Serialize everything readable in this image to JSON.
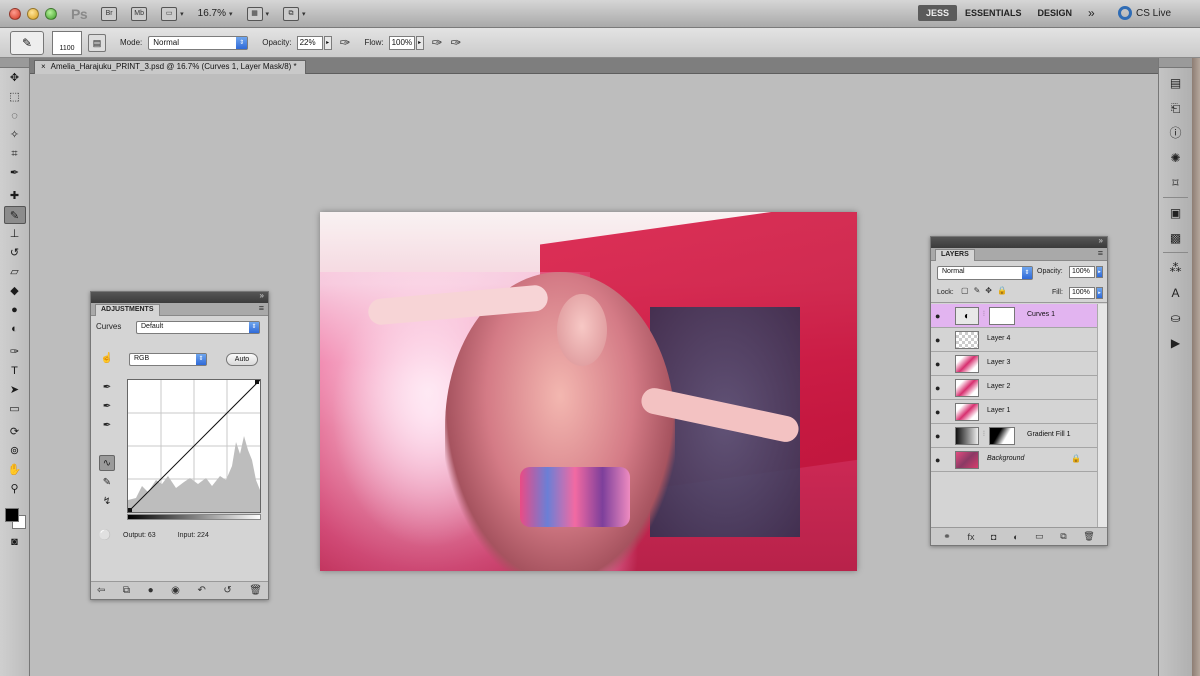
{
  "app": {
    "logo": "Ps",
    "zoom": "16.7%",
    "workspaces": [
      "JESS",
      "ESSENTIALS",
      "DESIGN"
    ],
    "active_workspace": "JESS",
    "more_label": "»",
    "cs_live": "CS Live"
  },
  "options": {
    "brush_size": "1100",
    "mode_label": "Mode:",
    "mode_value": "Normal",
    "opacity_label": "Opacity:",
    "opacity_value": "22%",
    "flow_label": "Flow:",
    "flow_value": "100%"
  },
  "document": {
    "tab_title": "Amelia_Harajuku_PRINT_3.psd @ 16.7% (Curves 1, Layer Mask/8) *",
    "close": "×"
  },
  "adjustments": {
    "panel_title": "ADJUSTMENTS",
    "curves_label": "Curves",
    "preset_value": "Default",
    "channel_value": "RGB",
    "auto_label": "Auto",
    "output_label": "Output: 63",
    "input_label": "Input: 224"
  },
  "layers": {
    "panel_title": "LAYERS",
    "blend_mode": "Normal",
    "opacity_label": "Opacity:",
    "opacity_value": "100%",
    "lock_label": "Lock:",
    "fill_label": "Fill:",
    "fill_value": "100%",
    "items": [
      {
        "name": "Curves 1",
        "active": true
      },
      {
        "name": "Layer 4",
        "active": false
      },
      {
        "name": "Layer 3",
        "active": false
      },
      {
        "name": "Layer 2",
        "active": false
      },
      {
        "name": "Layer 1",
        "active": false
      },
      {
        "name": "Gradient Fill 1",
        "active": false
      },
      {
        "name": "Background",
        "active": false
      }
    ]
  },
  "colors": {
    "active_layer": "#e2b4f0",
    "accent_blue": "#2f6ad8",
    "foreground": "#000000",
    "background": "#ffffff"
  }
}
